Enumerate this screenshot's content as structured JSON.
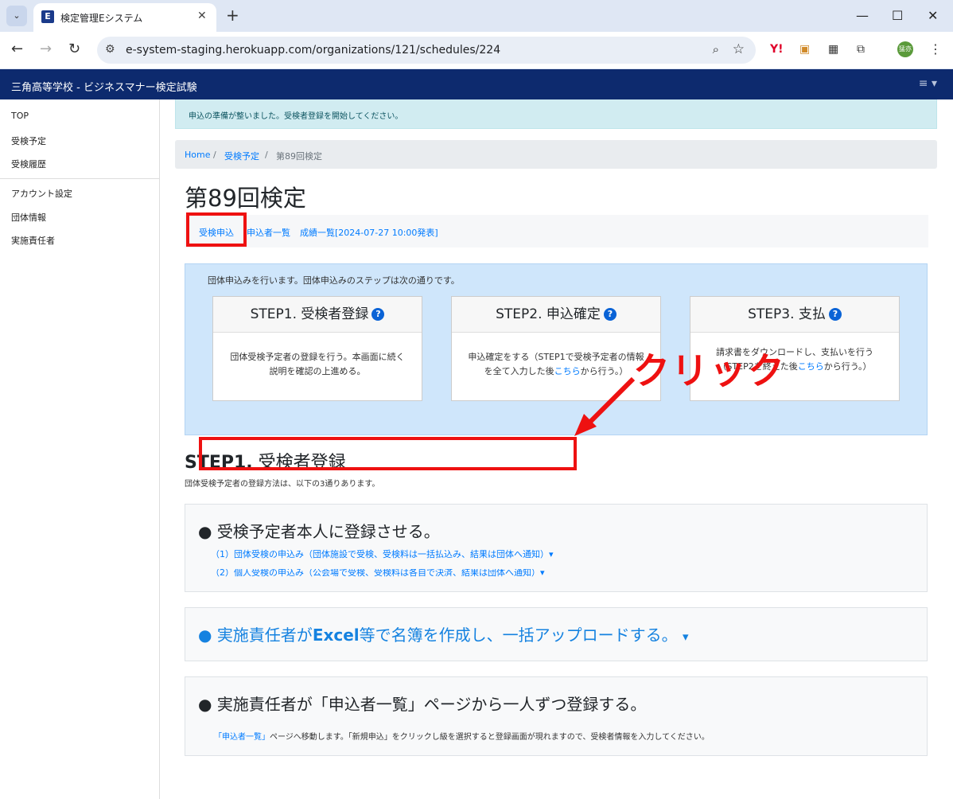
{
  "browser": {
    "tab_title": "検定管理Eシステム",
    "favicon_letter": "E",
    "url": "e-system-staging.herokuapp.com/organizations/121/schedules/224",
    "avatar_text": "猛亦"
  },
  "app": {
    "brand": "三角高等学校 - ビジネスマナー検定試験",
    "menu_icon": "≡ ▾"
  },
  "sidebar": {
    "items": [
      "TOP",
      "受検予定",
      "受検履歴",
      "アカウント設定",
      "団体情報",
      "実施責任者"
    ]
  },
  "alert": "申込の準備が整いました。受検者登録を開始してください。",
  "breadcrumb": {
    "home": "Home",
    "sep1": "/",
    "schedule": "受検予定",
    "sep2": "/",
    "current": "第89回検定"
  },
  "page_title": "第89回検定",
  "subnav": {
    "apply": "受検申込",
    "applicants": "申込者一覧",
    "results": "成績一覧[2024-07-27 10:00発表]"
  },
  "steps": {
    "intro": "団体申込みを行います。団体申込みのステップは次の通りです。",
    "cards": [
      {
        "title": "STEP1. 受検者登録",
        "line1": "団体受検予定者の登録を行う。本画面に続く",
        "line2": "説明を確認の上進める。"
      },
      {
        "title": "STEP2. 申込確定",
        "line1": "申込確定をする（STEP1で受検予定者の情報",
        "line2_pre": "を全て入力した後",
        "line2_link": "こちら",
        "line2_post": "から行う。）"
      },
      {
        "title": "STEP3. 支払",
        "line1": "請求書をダウンロードし、支払いを行う",
        "line2_pre": "（STEP2を終えた後",
        "line2_link": "こちら",
        "line2_post": "から行う。）"
      }
    ]
  },
  "step1": {
    "heading_en": "STEP1.",
    "heading_ja": "受検者登録",
    "lead": "団体受検予定者の登録方法は、以下の3通りあります。",
    "option1": {
      "title": "受検予定者本人に登録させる。",
      "sub1": "（1）団体受検の申込み（団体施設で受検、受検料は一括払込み、結果は団体へ通知）▾",
      "sub2": "（2）個人受検の申込み（公会場で受検、受検料は各自で決済、結果は団体へ通知）▾"
    },
    "option2": {
      "title_pre": "実施責任者が",
      "title_bold": "Excel",
      "title_post": "等で名簿を作成し、一括アップロードする。",
      "caret": "▾"
    },
    "option3": {
      "title": "実施責任者が「申込者一覧」ページから一人ずつ登録する。",
      "note_link": "「申込者一覧」",
      "note_text": "ページへ移動します。「新規申込」をクリックし級を選択すると登録画面が現れますので、受検者情報を入力してください。"
    }
  },
  "annotation": {
    "label": "クリック",
    "color": "#ee1111"
  }
}
